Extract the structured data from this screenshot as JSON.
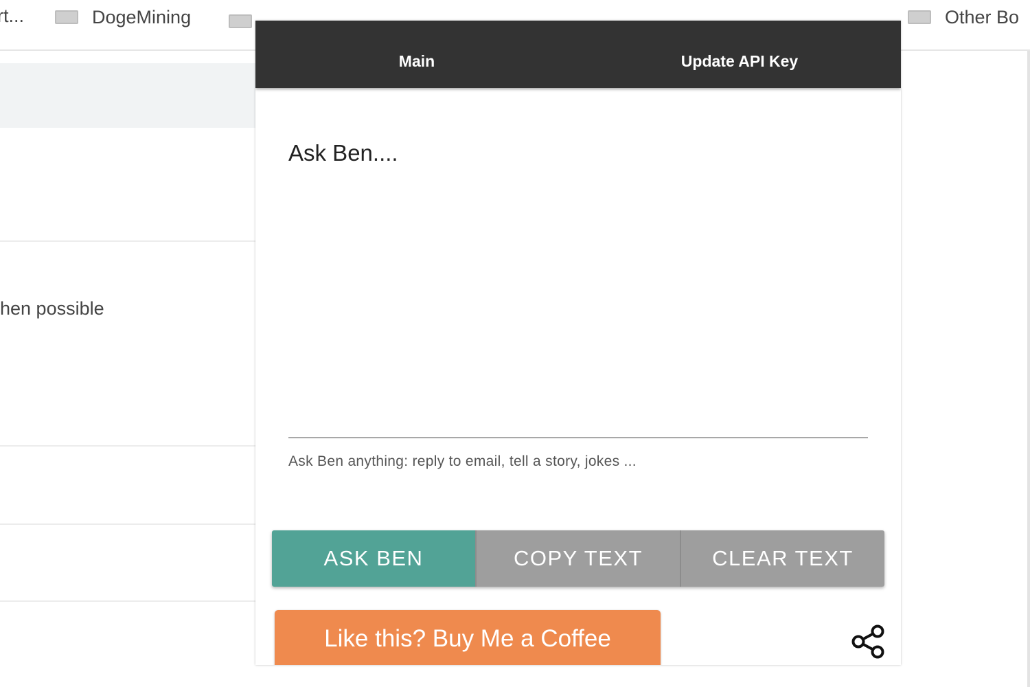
{
  "browser": {
    "bookmarks": [
      {
        "label": "rt..."
      },
      {
        "label": "DogeMining"
      },
      {
        "label": ""
      },
      {
        "label": "Other Bo"
      }
    ],
    "background_text": "hen possible"
  },
  "popup": {
    "tabs": [
      {
        "label": "Main"
      },
      {
        "label": "Update API Key"
      }
    ],
    "prompt": {
      "placeholder": "Ask Ben....",
      "value": "",
      "helper_text": "Ask Ben anything: reply to email, tell a story, jokes ..."
    },
    "buttons": {
      "ask": "ASK BEN",
      "copy": "COPY TEXT",
      "clear": "CLEAR TEXT"
    },
    "coffee_button": "Like this? Buy Me a Coffee",
    "share_icon": "share-icon"
  },
  "colors": {
    "tabbar": "#333333",
    "ask_button": "#52a396",
    "secondary_button": "#9e9e9e",
    "coffee_button": "#ef8a4e"
  }
}
